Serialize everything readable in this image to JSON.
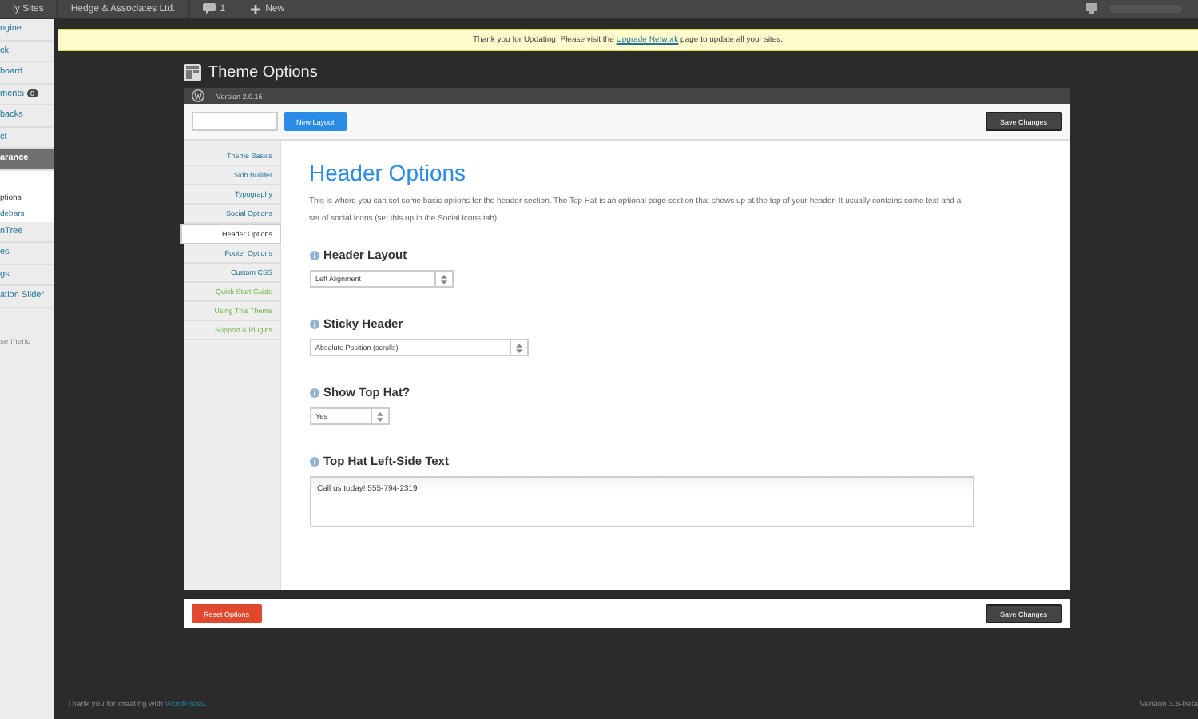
{
  "admin_bar": {
    "items": [
      "ly Sites",
      "Hedge & Associates Ltd."
    ],
    "comments": "1",
    "new_label": "New"
  },
  "sidebar": {
    "items": [
      {
        "label": "ngine",
        "kind": "item",
        "selected": false
      },
      {
        "label": "ck",
        "kind": "item",
        "selected": false
      },
      {
        "label": "board",
        "kind": "item",
        "selected": false
      },
      {
        "label": "ments",
        "kind": "item",
        "selected": false,
        "badge": "0"
      },
      {
        "label": "backs",
        "kind": "item",
        "selected": false
      },
      {
        "label": "ct",
        "kind": "item",
        "selected": false
      },
      {
        "label": "arance",
        "kind": "item",
        "selected": true
      },
      {
        "label": "ptions",
        "kind": "sub",
        "selected": true
      },
      {
        "label": "debars",
        "kind": "sub",
        "selected": false
      },
      {
        "label": "nTree",
        "kind": "item",
        "selected": false
      },
      {
        "label": "es",
        "kind": "item",
        "selected": false
      },
      {
        "label": "gs",
        "kind": "item",
        "selected": false
      },
      {
        "label": "ation Slider",
        "kind": "item",
        "selected": false
      },
      {
        "label": "se menu",
        "kind": "collapse"
      }
    ]
  },
  "notice": {
    "before": "Thank you for Updating! Please visit the",
    "link": "Upgrade Network",
    "after": "page to update all your sites."
  },
  "page_title": "Theme Options",
  "version": "Version 2.0.16",
  "toolbar": {
    "new_layout": "New Layout",
    "save": "Save Changes"
  },
  "tabs": [
    {
      "label": "Theme Basics",
      "kind": "option",
      "selected": false
    },
    {
      "label": "Skin Builder",
      "kind": "option",
      "selected": false
    },
    {
      "label": "Typography",
      "kind": "option",
      "selected": false
    },
    {
      "label": "Social Options",
      "kind": "option",
      "selected": false
    },
    {
      "label": "Header Options",
      "kind": "option",
      "selected": true
    },
    {
      "label": "Footer Options",
      "kind": "option",
      "selected": false
    },
    {
      "label": "Custom CSS",
      "kind": "option",
      "selected": false
    },
    {
      "label": "Quick Start Guide",
      "kind": "help",
      "selected": false
    },
    {
      "label": "Using This Theme",
      "kind": "help",
      "selected": false
    },
    {
      "label": "Support & Plugins",
      "kind": "help",
      "selected": false
    }
  ],
  "section": {
    "title": "Header Options",
    "description": "This is where you can set some basic options for the header section. The Top Hat is an optional page section that shows up at the top of your header. It usually contains some text and a set of social Icons (set this up in the Social Icons tab)."
  },
  "fields": [
    {
      "label": "Header Layout",
      "kind": "select",
      "value": "Left Alignment"
    },
    {
      "label": "Sticky Header",
      "kind": "select",
      "value": "Absolute Position (scrolls)"
    },
    {
      "label": "Show Top Hat?",
      "kind": "select",
      "value": "Yes"
    },
    {
      "label": "Top Hat Left-Side Text",
      "kind": "textarea",
      "value": "Call us today! 555-794-2319"
    }
  ],
  "footer_bar": {
    "reset": "Reset Options",
    "save": "Save Changes"
  },
  "footer": {
    "before": "Thank you for creating with",
    "link": "WordPress",
    "after": ".",
    "version": "Version 3.6-beta"
  }
}
